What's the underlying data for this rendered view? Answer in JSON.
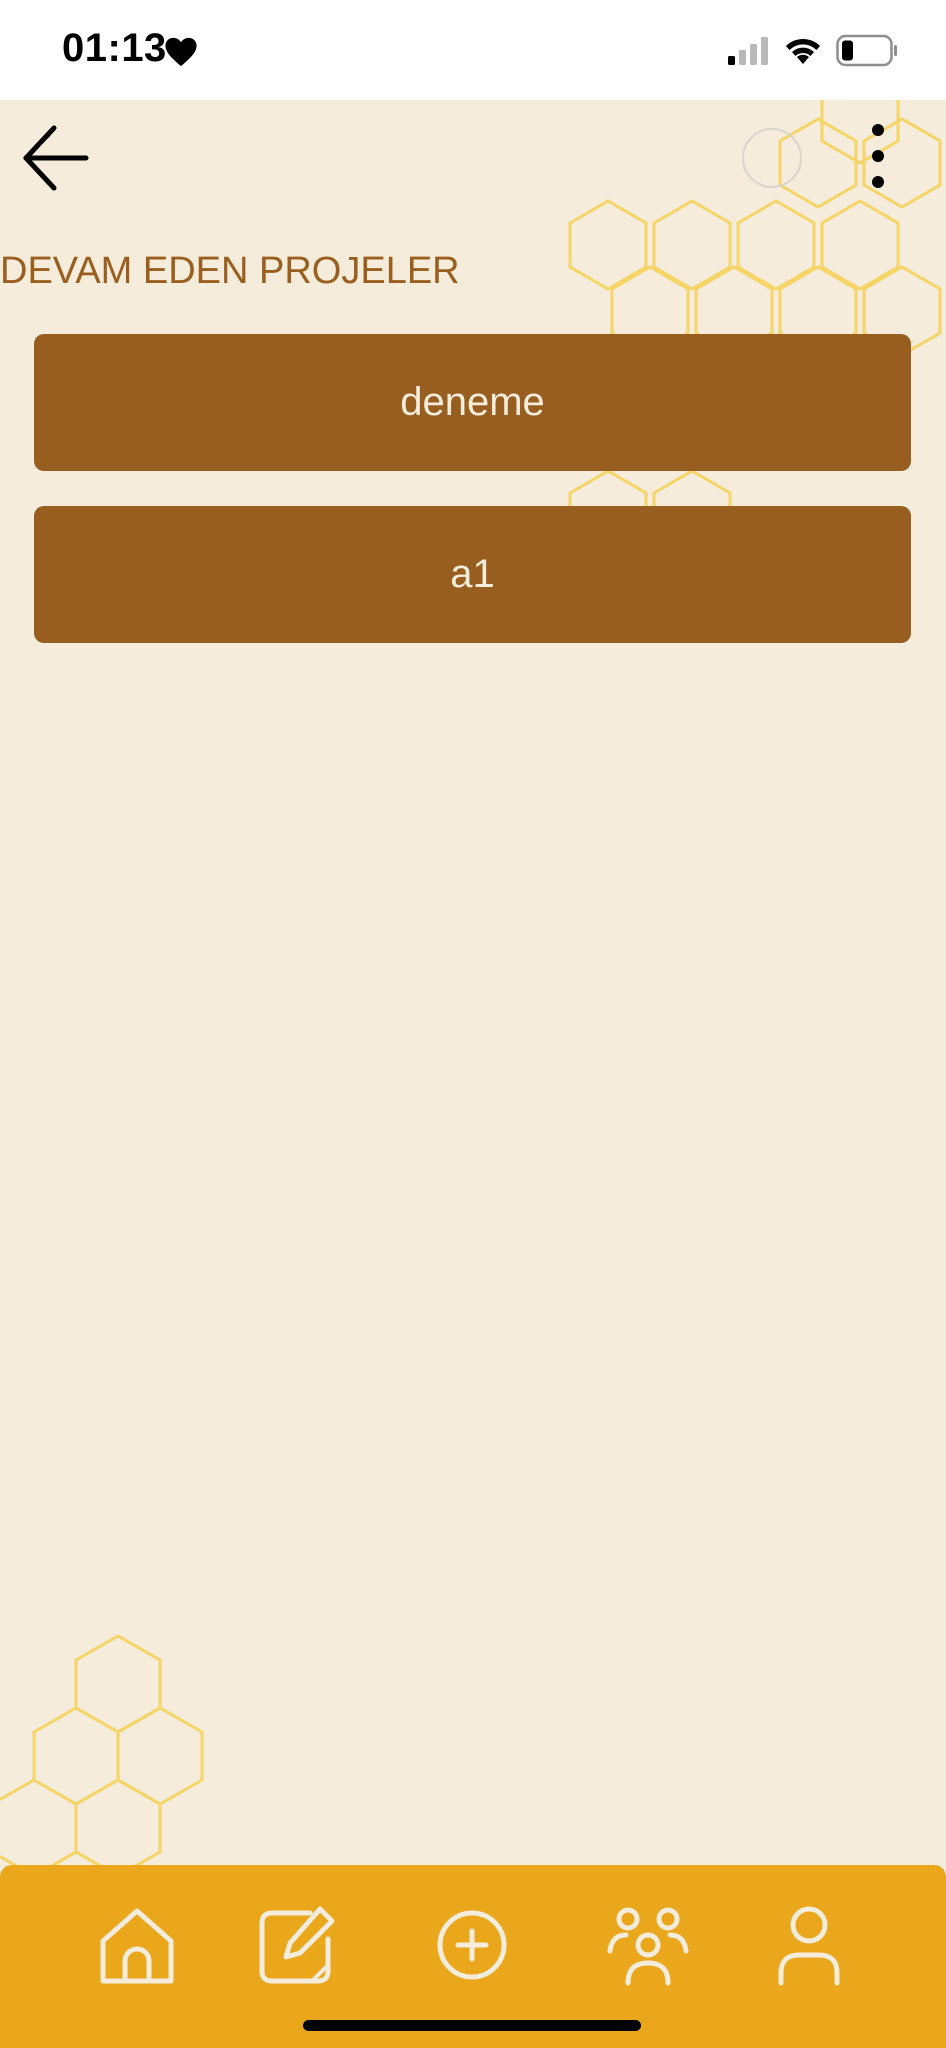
{
  "status_bar": {
    "time": "01:13",
    "icons": [
      "heart-icon",
      "cellular-signal-icon",
      "wifi-icon",
      "battery-icon"
    ]
  },
  "header": {
    "back_icon": "arrow-left-icon",
    "menu_icon": "more-vertical-icon"
  },
  "main": {
    "section_title": "DEVAM EDEN PROJELER",
    "projects": [
      {
        "label": "deneme"
      },
      {
        "label": "a1"
      }
    ]
  },
  "bottom_nav": {
    "items": [
      {
        "icon": "home-icon"
      },
      {
        "icon": "edit-icon"
      },
      {
        "icon": "add-circle-icon"
      },
      {
        "icon": "group-icon"
      },
      {
        "icon": "user-icon"
      }
    ]
  },
  "colors": {
    "background": "#f6ecdb",
    "accent_brown": "#985e1f",
    "nav_amber": "#eba71b",
    "honeycomb": "#f7d25a"
  }
}
